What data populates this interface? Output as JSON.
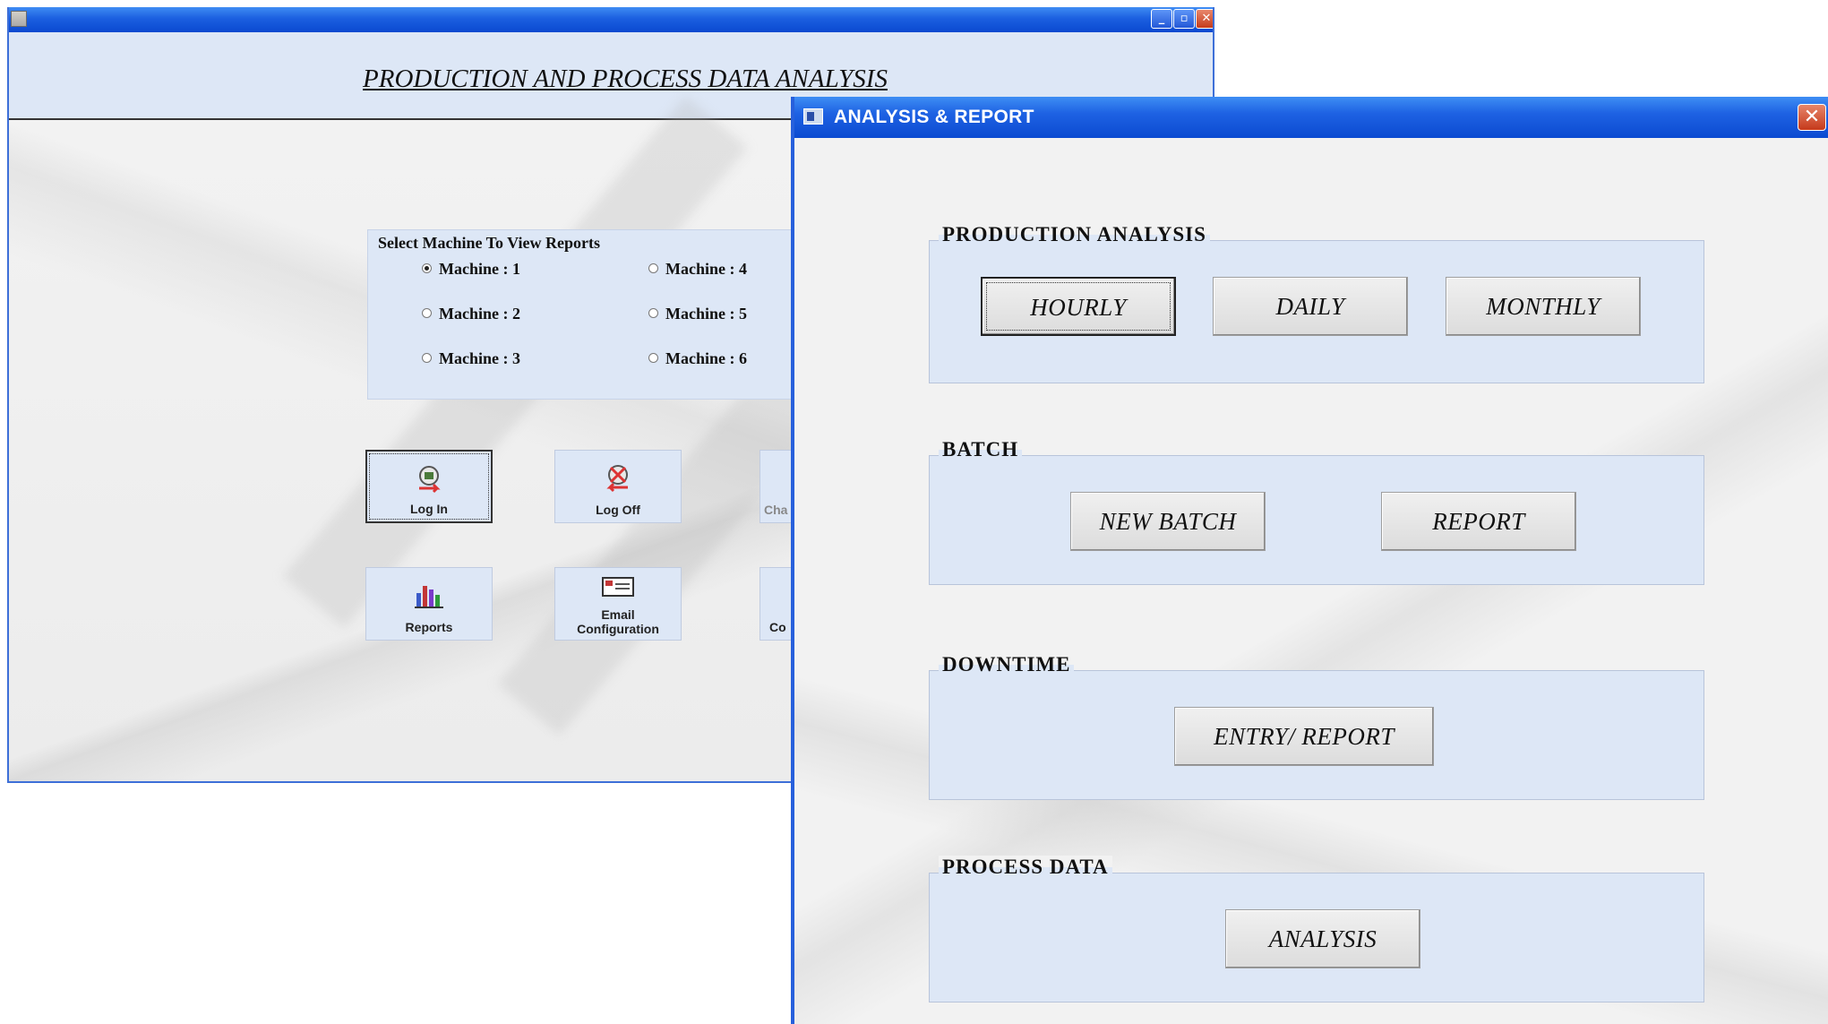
{
  "main_window": {
    "title": "PRODUCTION AND PROCESS DATA ANALYSIS",
    "machine_group": {
      "title": "Select Machine To View Reports",
      "options": [
        "Machine : 1",
        "Machine : 2",
        "Machine : 3",
        "Machine : 4",
        "Machine : 5",
        "Machine : 6"
      ],
      "selected": "Machine : 1"
    },
    "tool_buttons": {
      "login": "Log In",
      "logoff": "Log Off",
      "change_partial": "Cha",
      "reports": "Reports",
      "email_line1": "Email",
      "email_line2": "Configuration",
      "config_partial": "Co"
    },
    "icons": [
      "login-icon",
      "logoff-icon",
      "bar-chart-icon",
      "email-config-icon"
    ]
  },
  "dialog": {
    "title": "ANALYSIS & REPORT",
    "close_icon": "close-icon",
    "groups": {
      "production": {
        "title": "PRODUCTION ANALYSIS",
        "buttons": [
          "HOURLY",
          "DAILY",
          "MONTHLY"
        ]
      },
      "batch": {
        "title": "BATCH",
        "buttons": [
          "NEW BATCH",
          "REPORT"
        ]
      },
      "downtime": {
        "title": "DOWNTIME",
        "buttons": [
          "ENTRY/ REPORT"
        ]
      },
      "process": {
        "title": "PROCESS DATA",
        "buttons": [
          "ANALYSIS"
        ]
      }
    }
  },
  "colors": {
    "titlebar": "#1e62e3",
    "panel": "#dde7f6",
    "close": "#c5391b"
  }
}
